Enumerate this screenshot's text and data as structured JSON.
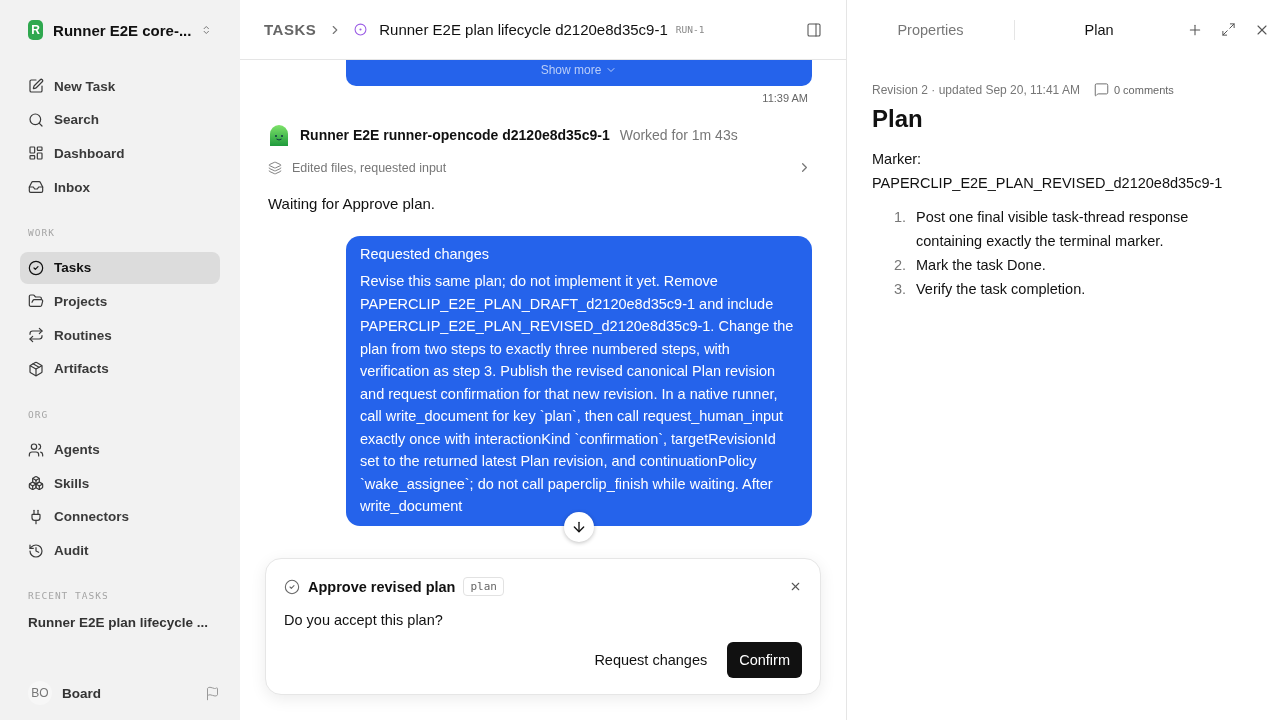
{
  "sidebar": {
    "workspace": {
      "initial": "R",
      "name": "Runner E2E core-..."
    },
    "nav": [
      {
        "label": "New Task",
        "selected": false
      },
      {
        "label": "Search",
        "selected": false
      },
      {
        "label": "Dashboard",
        "selected": false
      },
      {
        "label": "Inbox",
        "selected": false
      }
    ],
    "sections": [
      {
        "title": "WORK",
        "items": [
          {
            "label": "Tasks",
            "selected": true
          },
          {
            "label": "Projects",
            "selected": false
          },
          {
            "label": "Routines",
            "selected": false
          },
          {
            "label": "Artifacts",
            "selected": false
          }
        ]
      },
      {
        "title": "ORG",
        "items": [
          {
            "label": "Agents",
            "selected": false
          },
          {
            "label": "Skills",
            "selected": false
          },
          {
            "label": "Connectors",
            "selected": false
          },
          {
            "label": "Audit",
            "selected": false
          }
        ]
      }
    ],
    "recent": {
      "title": "RECENT TASKS",
      "items": [
        "Runner E2E plan lifecycle ..."
      ]
    },
    "user": {
      "initials": "BO",
      "name": "Board"
    }
  },
  "header": {
    "breadcrumb": "TASKS",
    "title": "Runner E2E plan lifecycle d2120e8d35c9-1",
    "run_id": "RUN-1"
  },
  "chat": {
    "previous": {
      "show_more": "Show more",
      "time": "11:39 AM"
    },
    "agent": {
      "name": "Runner E2E runner-opencode d2120e8d35c9-1",
      "duration": "Worked for 1m 43s",
      "activity": "Edited files, requested input",
      "text": "Waiting for Approve plan."
    },
    "request": {
      "title": "Requested changes",
      "body": "Revise this same plan; do not implement it yet. Remove PAPERCLIP_E2E_PLAN_DRAFT_d2120e8d35c9-1 and include PAPERCLIP_E2E_PLAN_REVISED_d2120e8d35c9-1. Change the plan from two steps to exactly three numbered steps, with verification as step 3. Publish the revised canonical Plan revision and request confirmation for that new revision. In a native runner, call write_document for key `plan`, then call request_human_input exactly once with interactionKind `confirmation`, targetRevisionId set to the returned latest Plan revision, and continuationPolicy `wake_assignee`; do not call paperclip_finish while waiting. After write_document"
    }
  },
  "prompt": {
    "title": "Approve revised plan",
    "tag": "plan",
    "question": "Do you accept this plan?",
    "buttons": [
      {
        "label": "Request changes",
        "kind": "secondary"
      },
      {
        "label": "Confirm",
        "kind": "primary"
      }
    ]
  },
  "panel": {
    "tabs": [
      {
        "label": "Properties",
        "selected": false
      },
      {
        "label": "Plan",
        "selected": true
      }
    ],
    "meta": "Revision 2 · updated Sep 20, 11:41 AM",
    "comments": "0 comments",
    "title": "Plan",
    "marker_label": "Marker:",
    "marker": "PAPERCLIP_E2E_PLAN_REVISED_d2120e8d35c9-1",
    "steps": [
      {
        "number": "1.",
        "text": "Post one final visible task-thread response containing exactly the terminal marker."
      },
      {
        "number": "2.",
        "text": "Mark the task Done."
      },
      {
        "number": "3.",
        "text": "Verify the task completion."
      }
    ]
  }
}
